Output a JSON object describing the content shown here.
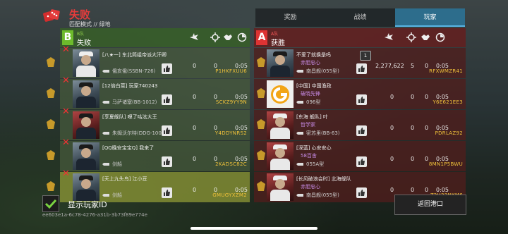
{
  "header": {
    "title": "失败",
    "subtitle": "匹配模式 // 绿地"
  },
  "tabs": [
    {
      "label": "奖励"
    },
    {
      "label": "战绩"
    },
    {
      "label": "玩家"
    }
  ],
  "active_tab": "玩家",
  "left_team": {
    "letter": "B",
    "sub": "B队",
    "result": "失败",
    "players": [
      {
        "name": "[八★一] 东北简组帝派大汗卿",
        "ship": "俄亥俄(SSBN-726)",
        "s1": "0",
        "s2": "0",
        "time": "0:05",
        "id": "P1HKFXUU6",
        "dead": true
      },
      {
        "name": "[12倍白菜] 玩家740243",
        "ship": "马萨诸塞(BB-1012)",
        "s1": "0",
        "s2": "0",
        "time": "0:05",
        "id": "SCKZ9YY9N",
        "dead": true
      },
      {
        "name": "[享夏舰队] 哩了咕泫大王",
        "ship": "朱姆沃尔特(DDG-1000)",
        "s1": "0",
        "s2": "0",
        "time": "0:05",
        "id": "Y4DDYNRS2",
        "dead": true
      },
      {
        "name": "[QQ晚安宝宝Q] 我来了",
        "ship": "剑船",
        "s1": "0",
        "s2": "0",
        "time": "0:05",
        "id": "2KADSC82C",
        "dead": true
      },
      {
        "name": "[天上九头鸟] 江小豆",
        "ship": "剑船",
        "s1": "0",
        "s2": "0",
        "time": "0:05",
        "id": "GMUGYXZM2",
        "dead": true
      }
    ]
  },
  "right_team": {
    "letter": "A",
    "sub": "A队",
    "result": "获胜",
    "players": [
      {
        "name": "不爱了就换是吗",
        "title": "赤胆忠心",
        "ship": "南昌舰(055型)",
        "s1": "2,277,622",
        "s2": "5",
        "s3": "0",
        "time": "0:05",
        "id": "RFXWMZR41",
        "count": "1"
      },
      {
        "name": "[中国] 中国渔政",
        "title": "破晓先锋",
        "ship": "096型",
        "s1": "0",
        "s2": "0",
        "s3": "0",
        "time": "0:05",
        "id": "Y6E621EE3"
      },
      {
        "name": "[东海 舰队] 叶",
        "title": "哲学家",
        "ship": "密苏里(BB-63)",
        "s1": "0",
        "s2": "0",
        "s3": "0",
        "time": "0:05",
        "id": "PDRLAZ92"
      },
      {
        "name": "[深蓝] 心安安心",
        "title": "58百舍",
        "ship": "055A型",
        "s1": "0",
        "s2": "0",
        "s3": "0",
        "time": "0:05",
        "id": "8MN1P5BWU"
      },
      {
        "name": "[长风破浪会时] 北海舰队",
        "title": "赤胆忠心",
        "ship": "南昌舰(055型)",
        "s1": "0",
        "s2": "0",
        "s3": "0",
        "time": "0:05",
        "id": "T2U33NKM6"
      }
    ]
  },
  "footer": {
    "show_id_label": "显示玩家ID",
    "uid": "ee603e1a-6c78-4276-a31b-3b73f89e774e",
    "back_label": "返回港口"
  },
  "icons": {
    "dice": "dice-icon",
    "plane": "plane-icon",
    "crosshair": "crosshair-icon",
    "handshake": "handshake-icon",
    "time": "clock-icon",
    "like": "thumbs-up-icon"
  },
  "colors": {
    "defeat": "#e53c3c",
    "team_b": "#6dbb2c",
    "team_a": "#dd3333",
    "id": "#f0c23a"
  }
}
